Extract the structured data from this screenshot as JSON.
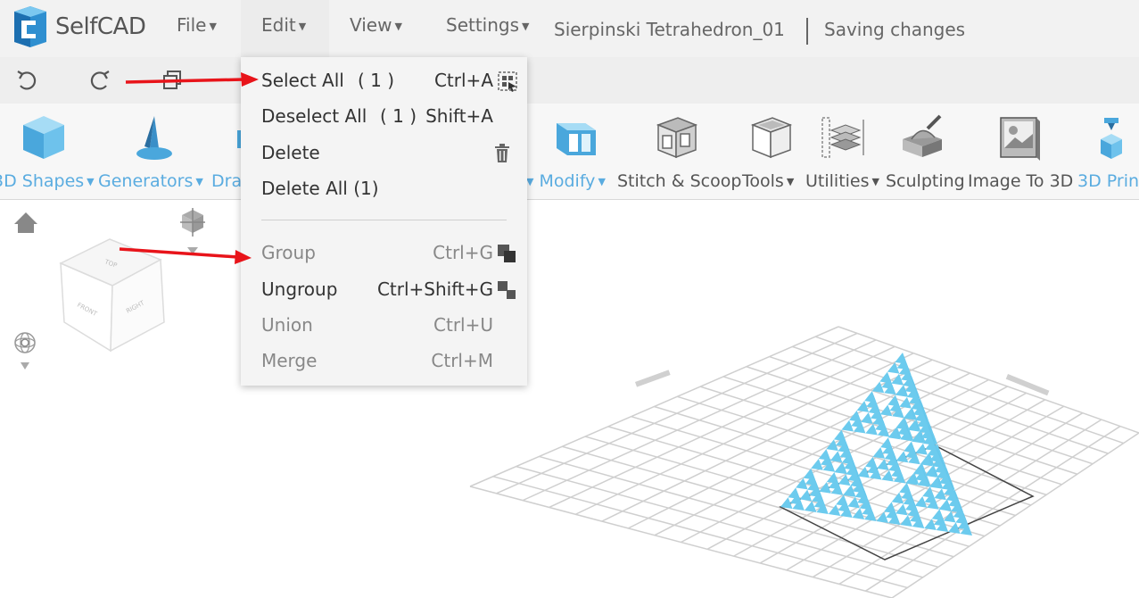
{
  "app": {
    "name": "SelfCAD"
  },
  "menubar": {
    "items": [
      {
        "label": "File"
      },
      {
        "label": "Edit"
      },
      {
        "label": "View"
      },
      {
        "label": "Settings"
      }
    ],
    "document_title": "Sierpinski Tetrahedron_01",
    "save_status": "Saving changes"
  },
  "quickbar": {
    "icons": [
      "undo-icon",
      "redo-icon",
      "copy-icon"
    ]
  },
  "ribbon": {
    "tools": [
      {
        "label": "3D Shapes",
        "icon": "cube-icon",
        "dropdown": true
      },
      {
        "label": "Generators",
        "icon": "generator-icon",
        "dropdown": true
      },
      {
        "label": "Dra",
        "icon": "draw-icon",
        "dropdown": false
      },
      {
        "label": "Modify",
        "icon": "modify-icon",
        "dropdown": true
      },
      {
        "label": "Stitch & Scoop",
        "icon": "stitch-scoop-icon",
        "dropdown": false
      },
      {
        "label": "Tools",
        "icon": "tools-icon",
        "dropdown": true
      },
      {
        "label": "Utilities",
        "icon": "utilities-icon",
        "dropdown": true
      },
      {
        "label": "Sculpting",
        "icon": "sculpting-icon",
        "dropdown": false
      },
      {
        "label": "Image To 3D",
        "icon": "image-to-3d-icon",
        "dropdown": false
      },
      {
        "label": "3D Prin",
        "icon": "3d-print-icon",
        "dropdown": false
      }
    ]
  },
  "viewcube": {
    "top": "TOP",
    "front": "FRONT",
    "right": "RIGHT"
  },
  "edit_menu": {
    "items": [
      {
        "label": "Select All",
        "count": "( 1 )",
        "shortcut": "Ctrl+A",
        "enabled": true
      },
      {
        "label": "Deselect All",
        "count": "( 1 )",
        "shortcut": "Shift+A",
        "enabled": true
      },
      {
        "label": "Delete",
        "count": "",
        "shortcut": "",
        "enabled": true
      },
      {
        "label": "Delete All (1)",
        "count": "",
        "shortcut": "",
        "enabled": true
      },
      {
        "label": "Group",
        "count": "",
        "shortcut": "Ctrl+G",
        "enabled": false
      },
      {
        "label": "Ungroup",
        "count": "",
        "shortcut": "Ctrl+Shift+G",
        "enabled": true
      },
      {
        "label": "Union",
        "count": "",
        "shortcut": "Ctrl+U",
        "enabled": false
      },
      {
        "label": "Merge",
        "count": "",
        "shortcut": "Ctrl+M",
        "enabled": false
      }
    ]
  },
  "colors": {
    "accent": "#5aace0",
    "model": "#6ccbee",
    "annotation": "#e8141a"
  }
}
